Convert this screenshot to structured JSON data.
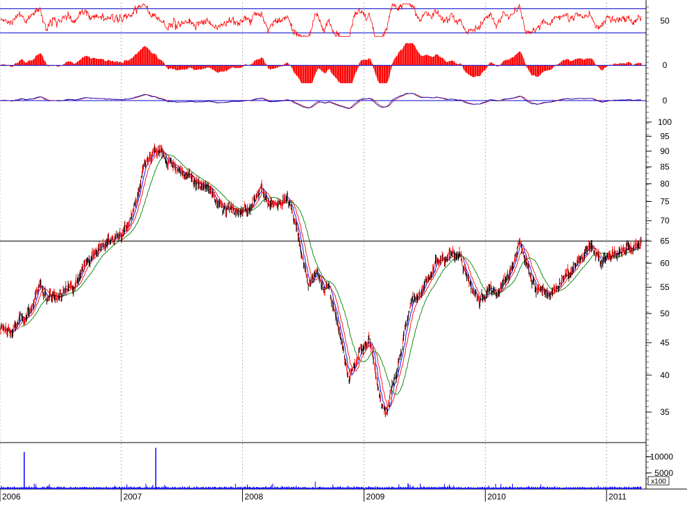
{
  "chart_data": [
    {
      "type": "line",
      "panel": "oscillator",
      "reference_lines": [
        70,
        30
      ],
      "y_tick_labels": [
        "50"
      ],
      "ylim": [
        20,
        80
      ],
      "series_color": "#ff0000"
    },
    {
      "type": "bar",
      "panel": "histogram",
      "y_tick_labels": [
        "0"
      ],
      "ylim": [
        -1.2,
        1.5
      ],
      "bar_color": "#ff0000"
    },
    {
      "type": "line",
      "panel": "momentum",
      "y_tick_labels": [
        "0"
      ],
      "ylim": [
        -1.0,
        1.0
      ],
      "series_colors": [
        "#0000cc",
        "#cc0000"
      ]
    },
    {
      "type": "candlestick",
      "panel": "price",
      "y_scale": "log",
      "ylim": [
        31.5,
        101
      ],
      "y_tick_labels": [
        "100",
        "95",
        "90",
        "85",
        "80",
        "75",
        "70",
        "65",
        "60",
        "55",
        "50",
        "45",
        "40",
        "35"
      ],
      "horizontal_line": 65,
      "moving_average_colors": [
        "#0000ff",
        "#ff0000",
        "#008000"
      ],
      "anchors": [
        [
          "2006-01-03",
          47
        ],
        [
          "2006-02-15",
          47.5
        ],
        [
          "2006-03-20",
          50
        ],
        [
          "2006-05-01",
          54
        ],
        [
          "2006-07-01",
          53
        ],
        [
          "2006-09-01",
          58
        ],
        [
          "2006-10-15",
          63
        ],
        [
          "2006-12-01",
          65
        ],
        [
          "2007-01-15",
          68
        ],
        [
          "2007-02-15",
          74
        ],
        [
          "2007-03-15",
          85
        ],
        [
          "2007-04-15",
          90
        ],
        [
          "2007-05-15",
          88
        ],
        [
          "2007-06-15",
          85
        ],
        [
          "2007-07-15",
          83
        ],
        [
          "2007-08-15",
          80
        ],
        [
          "2007-09-15",
          79
        ],
        [
          "2007-10-15",
          76
        ],
        [
          "2007-11-15",
          74
        ],
        [
          "2007-12-15",
          72
        ],
        [
          "2008-01-20",
          73
        ],
        [
          "2008-02-25",
          80
        ],
        [
          "2008-03-20",
          74
        ],
        [
          "2008-04-15",
          75
        ],
        [
          "2008-05-15",
          76
        ],
        [
          "2008-06-15",
          68
        ],
        [
          "2008-07-15",
          55
        ],
        [
          "2008-08-15",
          58
        ],
        [
          "2008-09-15",
          55
        ],
        [
          "2008-10-15",
          47
        ],
        [
          "2008-11-15",
          40
        ],
        [
          "2008-12-15",
          43
        ],
        [
          "2009-01-15",
          46
        ],
        [
          "2009-02-15",
          38
        ],
        [
          "2009-03-10",
          35.5
        ],
        [
          "2009-04-15",
          42
        ],
        [
          "2009-05-15",
          50
        ],
        [
          "2009-06-15",
          54
        ],
        [
          "2009-07-15",
          57
        ],
        [
          "2009-08-15",
          60
        ],
        [
          "2009-09-15",
          61
        ],
        [
          "2009-10-15",
          63
        ],
        [
          "2009-11-15",
          55
        ],
        [
          "2009-12-15",
          52
        ],
        [
          "2010-01-15",
          55
        ],
        [
          "2010-02-15",
          54
        ],
        [
          "2010-03-15",
          58
        ],
        [
          "2010-04-15",
          64
        ],
        [
          "2010-05-15",
          58
        ],
        [
          "2010-06-15",
          54
        ],
        [
          "2010-07-15",
          53
        ],
        [
          "2010-08-15",
          56
        ],
        [
          "2010-09-15",
          58
        ],
        [
          "2010-10-15",
          62
        ],
        [
          "2010-11-15",
          64
        ],
        [
          "2010-12-15",
          60
        ],
        [
          "2011-01-15",
          61
        ],
        [
          "2011-02-15",
          64
        ],
        [
          "2011-03-15",
          63
        ],
        [
          "2011-04-15",
          65
        ]
      ]
    },
    {
      "type": "bar",
      "panel": "volume",
      "y_tick_labels": [
        "10000",
        "5000"
      ],
      "unit_label": "x100",
      "ylim": [
        0,
        14000
      ],
      "bar_color": "#0000ff",
      "spikes": [
        [
          "2006-03-15",
          11500
        ],
        [
          "2007-04-15",
          12800
        ]
      ]
    }
  ],
  "x_axis": {
    "range": [
      "2006-01-01",
      "2011-04-30"
    ],
    "year_labels": [
      "2006",
      "2007",
      "2008",
      "2009",
      "2010",
      "2011"
    ]
  }
}
